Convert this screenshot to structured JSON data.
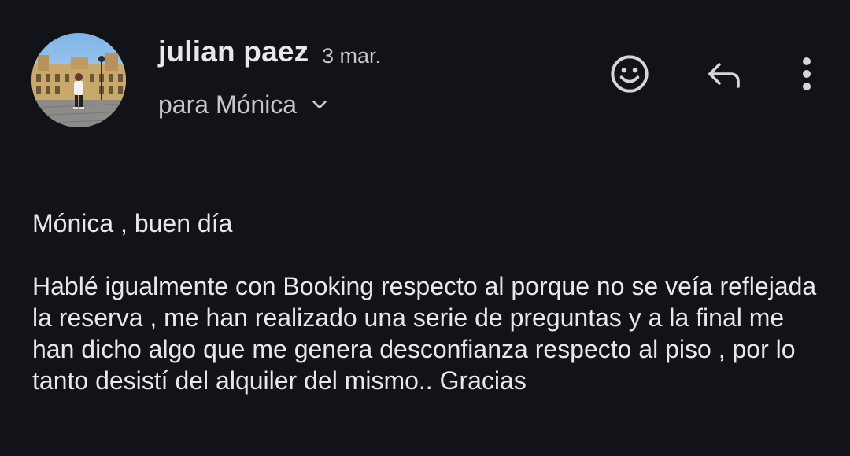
{
  "header": {
    "sender_name": "julian paez",
    "date": "3 mar.",
    "recipient": "para Mónica",
    "avatar_icon": "profile-photo"
  },
  "actions": {
    "emoji_icon": "smiley-face-icon",
    "reply_icon": "reply-arrow-icon",
    "more_icon": "more-vertical-icon"
  },
  "email": {
    "greeting": "Mónica , buen día",
    "message": "Hablé igualmente con Booking respecto al porque no se veía reflejada la reserva , me han realizado una serie de preguntas y a la final me han dicho algo que me genera desconfianza respecto al piso , por lo tanto desistí del alquiler del mismo.. Gracias"
  },
  "colors": {
    "background": "#111318",
    "primary_text": "#e8e8e8",
    "secondary_text": "#c4c7cc"
  }
}
